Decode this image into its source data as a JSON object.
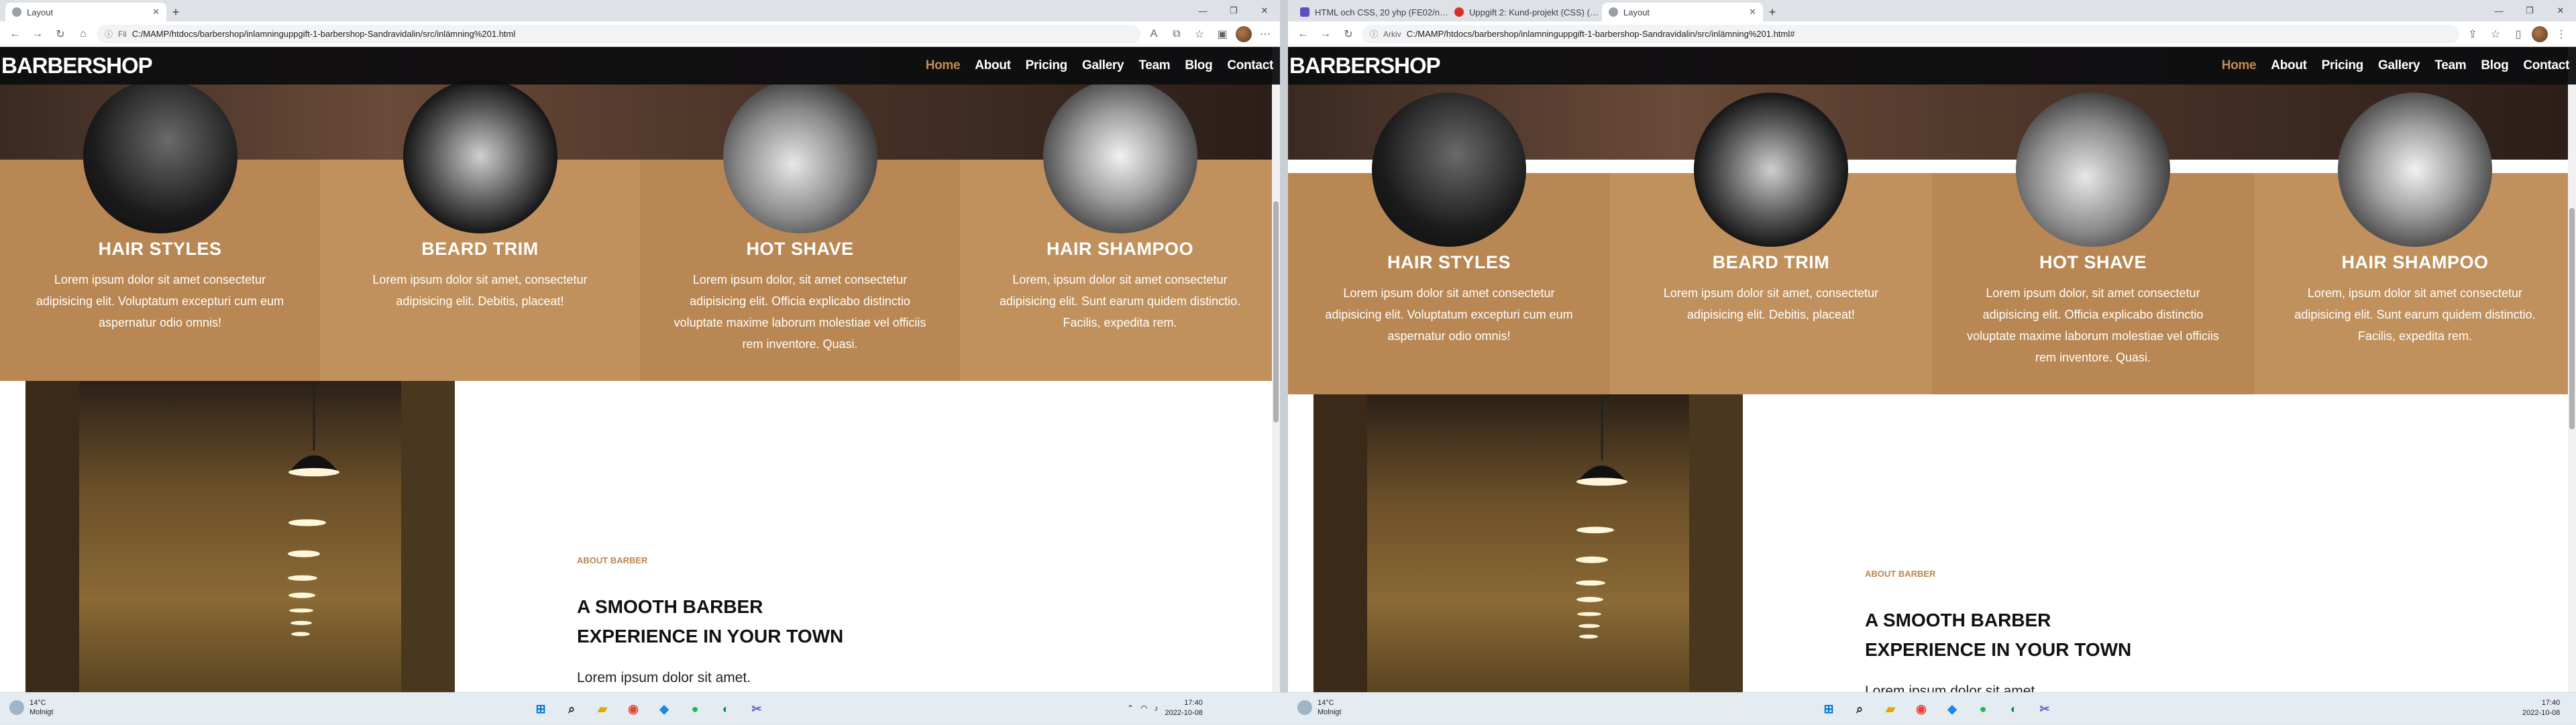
{
  "left_window": {
    "tabs": [
      {
        "title": "Layout",
        "active": true
      }
    ],
    "new_tab": "+",
    "window_controls": [
      "—",
      "❐",
      "✕"
    ],
    "address": {
      "prefix": "Fil",
      "url": "C:/MAMP/htdocs/barbershop/inlamninguppgift-1-barbershop-Sandravidalin/src/inlämning%201.html"
    }
  },
  "right_window": {
    "tabs": [
      {
        "title": "HTML och CSS, 20 yhp (FE02/n…"
      },
      {
        "title": "Uppgift 2: Kund-projekt (CSS) (…"
      },
      {
        "title": "Layout",
        "active": true
      }
    ],
    "new_tab": "+",
    "window_controls": [
      "—",
      "❐",
      "✕"
    ],
    "address": {
      "prefix": "Arkiv",
      "url": "C:/MAMP/htdocs/barbershop/inlamninguppgift-1-barbershop-Sandravidalin/src/inlämning%201.html#"
    }
  },
  "site": {
    "logo": "BARBERSHOP",
    "nav": [
      "Home",
      "About",
      "Pricing",
      "Gallery",
      "Team",
      "Blog",
      "Contact"
    ],
    "active_nav": "Home",
    "services": [
      {
        "title": "HAIR STYLES",
        "text": "Lorem ipsum dolor sit amet consectetur adipisicing elit. Voluptatum excepturi cum eum aspernatur odio omnis!"
      },
      {
        "title": "BEARD TRIM",
        "text": "Lorem ipsum dolor sit amet, consectetur adipisicing elit. Debitis, placeat!"
      },
      {
        "title": "HOT SHAVE",
        "text": "Lorem ipsum dolor, sit amet consectetur adipisicing elit. Officia explicabo distinctio voluptate maxime laborum molestiae vel officiis rem inventore. Quasi."
      },
      {
        "title": "HAIR SHAMPOO",
        "text": "Lorem, ipsum dolor sit amet consectetur adipisicing elit. Sunt earum quidem distinctio. Facilis, expedita rem."
      }
    ],
    "about": {
      "eyebrow": "ABOUT BARBER",
      "heading_line1": "A SMOOTH BARBER",
      "heading_line2": "EXPERIENCE IN YOUR TOWN",
      "body": "Lorem ipsum dolor sit amet."
    }
  },
  "taskbar": {
    "weather_temp": "14°C",
    "weather_desc": "Molnigt",
    "time": "17:40",
    "date": "2022-10-08"
  },
  "colors": {
    "accent": "#c58b55",
    "service_bg": "#b98753",
    "nav_bg": "#0e0e10"
  }
}
